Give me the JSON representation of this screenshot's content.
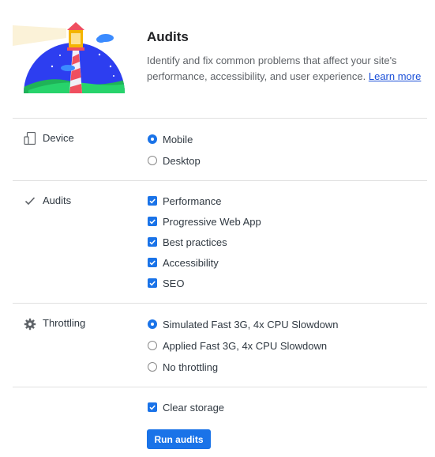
{
  "header": {
    "title": "Audits",
    "description": "Identify and fix common problems that affect your site's performance, accessibility, and user experience.",
    "learn_more": "Learn more"
  },
  "device": {
    "label": "Device",
    "icon": "device-icon",
    "options": [
      {
        "label": "Mobile",
        "selected": true
      },
      {
        "label": "Desktop",
        "selected": false
      }
    ]
  },
  "audits": {
    "label": "Audits",
    "icon": "checkmark-icon",
    "options": [
      {
        "label": "Performance",
        "checked": true
      },
      {
        "label": "Progressive Web App",
        "checked": true
      },
      {
        "label": "Best practices",
        "checked": true
      },
      {
        "label": "Accessibility",
        "checked": true
      },
      {
        "label": "SEO",
        "checked": true
      }
    ]
  },
  "throttling": {
    "label": "Throttling",
    "icon": "gear-icon",
    "options": [
      {
        "label": "Simulated Fast 3G, 4x CPU Slowdown",
        "selected": true
      },
      {
        "label": "Applied Fast 3G, 4x CPU Slowdown",
        "selected": false
      },
      {
        "label": "No throttling",
        "selected": false
      }
    ]
  },
  "storage": {
    "label": "Clear storage",
    "checked": true
  },
  "run_button": {
    "label": "Run audits"
  },
  "colors": {
    "accent": "#1a73e8",
    "link": "#1a4fd8",
    "divider": "#e0e0e0"
  }
}
